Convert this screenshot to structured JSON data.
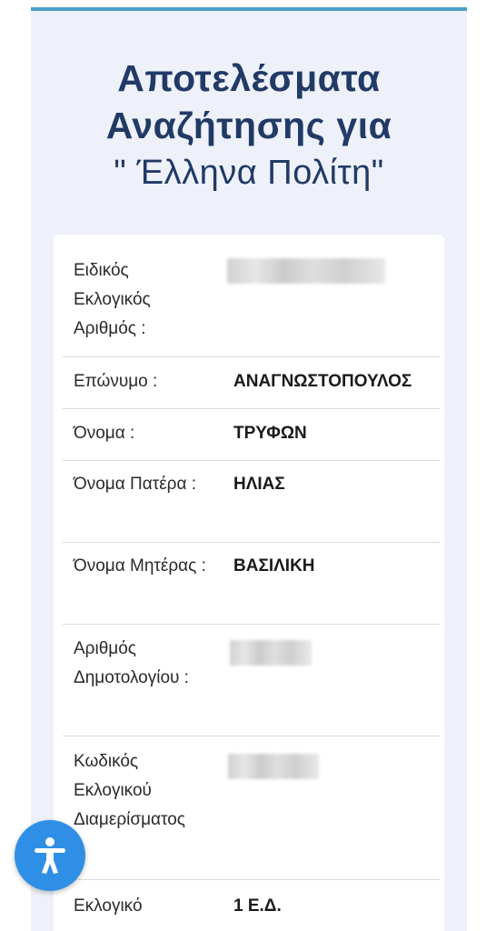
{
  "title": {
    "line1": "Αποτελέσματα",
    "line2": "Αναζήτησης για",
    "line3": "\" Έλληνα Πολίτη\""
  },
  "rows": [
    {
      "label": "Ειδικός Εκλογικός Αριθμός :",
      "value": ""
    },
    {
      "label": "Επώνυμο :",
      "value": "ΑΝΑΓΝΩΣΤΟΠΟΥΛΟΣ"
    },
    {
      "label": "Όνομα :",
      "value": "ΤΡΥΦΩΝ"
    },
    {
      "label": "Όνομα Πατέρα :",
      "value": "ΗΛΙΑΣ"
    },
    {
      "label": "Όνομα Μητέρας :",
      "value": "ΒΑΣΙΛΙΚΗ"
    },
    {
      "label": "Αριθμός Δημοτολογίου :",
      "value": ""
    },
    {
      "label": "Κωδικός Εκλογικού Διαμερίσματος",
      "value": ""
    },
    {
      "label": "Εκλογικό",
      "value": "1 Ε.Δ."
    }
  ],
  "accessibility_icon": "accessibility-person-icon",
  "colors": {
    "title": "#213a66",
    "accent_bar": "#4a9ec9",
    "panel_bg": "#eef1f9",
    "a11y_button": "#2f8fe6"
  }
}
